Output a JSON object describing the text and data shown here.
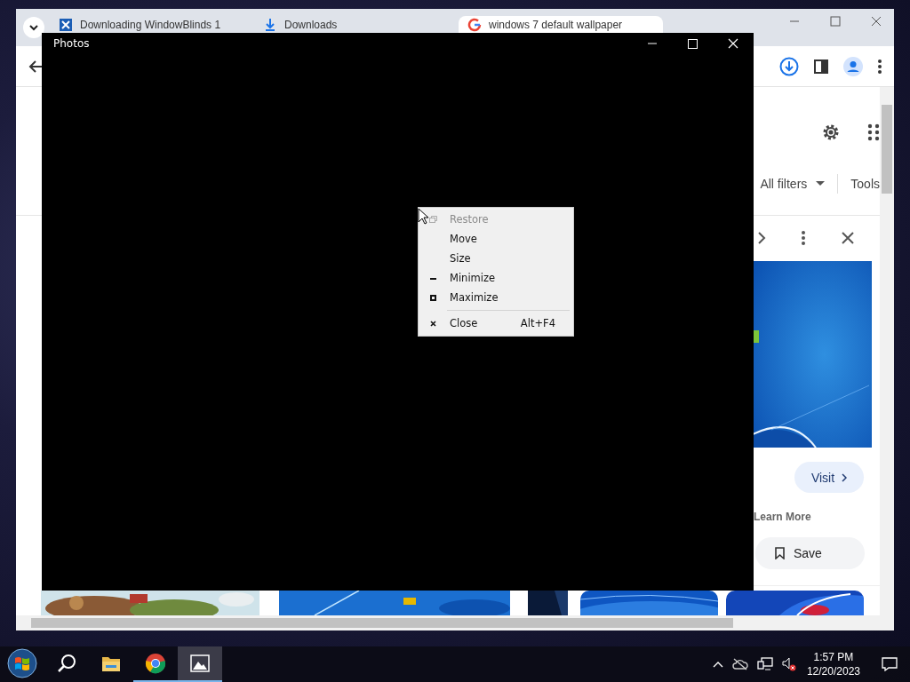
{
  "browser": {
    "tabs": [
      {
        "title": "Downloading WindowBlinds 1",
        "selected": false
      },
      {
        "title": "Downloads",
        "selected": false
      },
      {
        "title": "windows 7 default wallpaper",
        "selected": true
      }
    ],
    "filters": {
      "all_filters": "All filters",
      "tools": "Tools"
    },
    "side_panel": {
      "visit": "Visit",
      "learn_more": "Learn More",
      "save": "Save"
    }
  },
  "photos_window": {
    "title": "Photos"
  },
  "context_menu": {
    "items": [
      {
        "kind": "restore",
        "label": "Restore",
        "disabled": true
      },
      {
        "kind": "plain",
        "label": "Move",
        "disabled": false
      },
      {
        "kind": "plain",
        "label": "Size",
        "disabled": false
      },
      {
        "kind": "minimize",
        "label": "Minimize",
        "disabled": false
      },
      {
        "kind": "maximize",
        "label": "Maximize",
        "disabled": false
      },
      {
        "kind": "separator"
      },
      {
        "kind": "close",
        "label": "Close",
        "shortcut": "Alt+F4",
        "disabled": false
      }
    ]
  },
  "taskbar": {
    "apps": [
      {
        "kind": "start",
        "running": false,
        "selected": false
      },
      {
        "kind": "search",
        "running": false,
        "selected": false
      },
      {
        "kind": "explorer",
        "running": false,
        "selected": false
      },
      {
        "kind": "chrome",
        "running": true,
        "selected": false
      },
      {
        "kind": "photos",
        "running": true,
        "selected": true
      }
    ],
    "clock": {
      "time": "1:57 PM",
      "date": "12/20/2023"
    }
  }
}
